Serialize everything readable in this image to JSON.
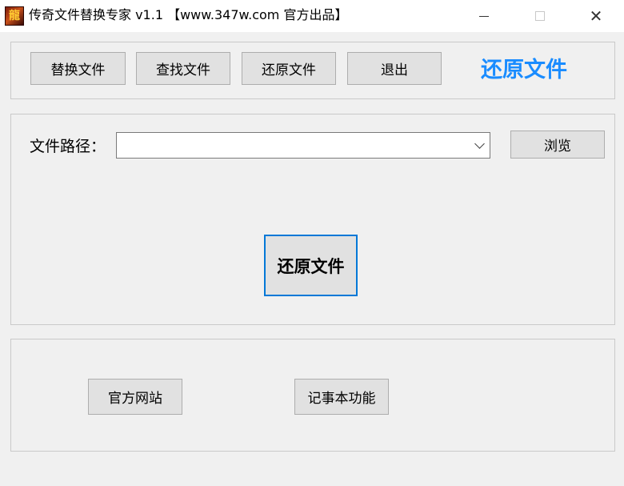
{
  "window": {
    "title": "传奇文件替换专家 v1.1 【www.347w.com 官方出品】",
    "icon_char": "龍",
    "controls": [
      "minimize",
      "maximize",
      "close"
    ],
    "close_symbol": "✕"
  },
  "toolbar": {
    "replace_label": "替换文件",
    "find_label": "查找文件",
    "restore_label": "还原文件",
    "exit_label": "退出",
    "mode_title": "还原文件",
    "mode_color": "#1a8cff"
  },
  "path_panel": {
    "label": "文件路径：",
    "path_value": "",
    "browse_label": "浏览",
    "action_label": "还原文件",
    "focus_color": "#0078d7"
  },
  "footer_panel": {
    "website_label": "官方网站",
    "notepad_label": "记事本功能"
  }
}
